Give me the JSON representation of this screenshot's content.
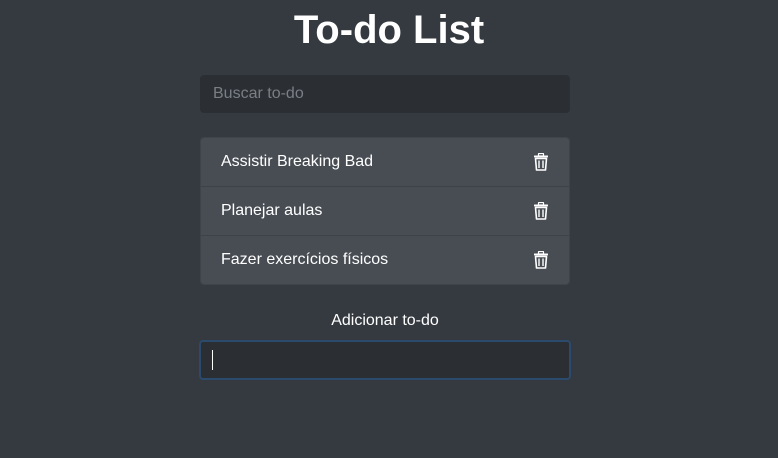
{
  "page": {
    "title": "To-do List"
  },
  "search": {
    "placeholder": "Buscar to-do",
    "value": ""
  },
  "todos": [
    {
      "text": "Assistir Breaking Bad",
      "icon": "trash-icon"
    },
    {
      "text": "Planejar aulas",
      "icon": "trash-icon"
    },
    {
      "text": "Fazer exercícios físicos",
      "icon": "trash-icon"
    }
  ],
  "add": {
    "label": "Adicionar to-do",
    "value": ""
  },
  "colors": {
    "background": "#343a40",
    "input_background": "#2b2f34",
    "list_item_background": "#484d54",
    "focus_border": "#2c4a6b",
    "text": "#ffffff"
  }
}
